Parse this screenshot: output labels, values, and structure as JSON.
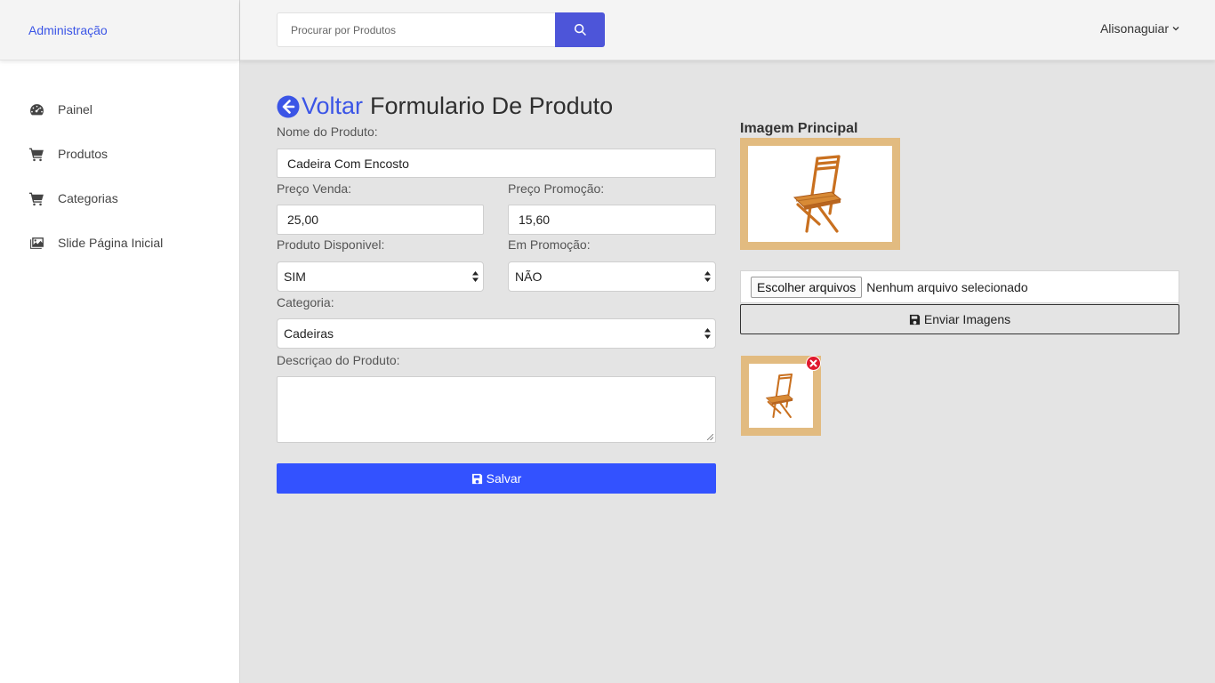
{
  "brand": "Administração",
  "sidebar": {
    "items": [
      {
        "label": "Painel",
        "icon": "tachometer-icon"
      },
      {
        "label": "Produtos",
        "icon": "cart-icon"
      },
      {
        "label": "Categorias",
        "icon": "cart-icon"
      },
      {
        "label": "Slide Página Inicial",
        "icon": "images-icon"
      }
    ]
  },
  "topbar": {
    "search_placeholder": "Procurar por Produtos",
    "user_name": "Alisonaguiar"
  },
  "form": {
    "back_label": "Voltar",
    "title": "Formulario De Produto",
    "name_label": "Nome do Produto:",
    "name_value": "Cadeira Com Encosto",
    "price_label": "Preço Venda:",
    "price_value": "25,00",
    "promo_price_label": "Preço Promoção:",
    "promo_price_value": "15,60",
    "available_label": "Produto Disponivel:",
    "available_value": "SIM",
    "on_promo_label": "Em Promoção:",
    "on_promo_value": "NÃO",
    "category_label": "Categoria:",
    "category_value": "Cadeiras",
    "description_label": "Descriçao do Produto:",
    "description_value": "",
    "save_label": "Salvar"
  },
  "images": {
    "main_title": "Imagem Principal",
    "choose_files_label": "Escolher arquivos",
    "no_file_label": "Nenhum arquivo selecionado",
    "send_label": "Enviar Imagens"
  },
  "colors": {
    "accent": "#3352ff",
    "link": "#3b55e6",
    "search_button": "#4d55d9",
    "image_frame": "#e2bb80",
    "remove": "#e0182d"
  }
}
